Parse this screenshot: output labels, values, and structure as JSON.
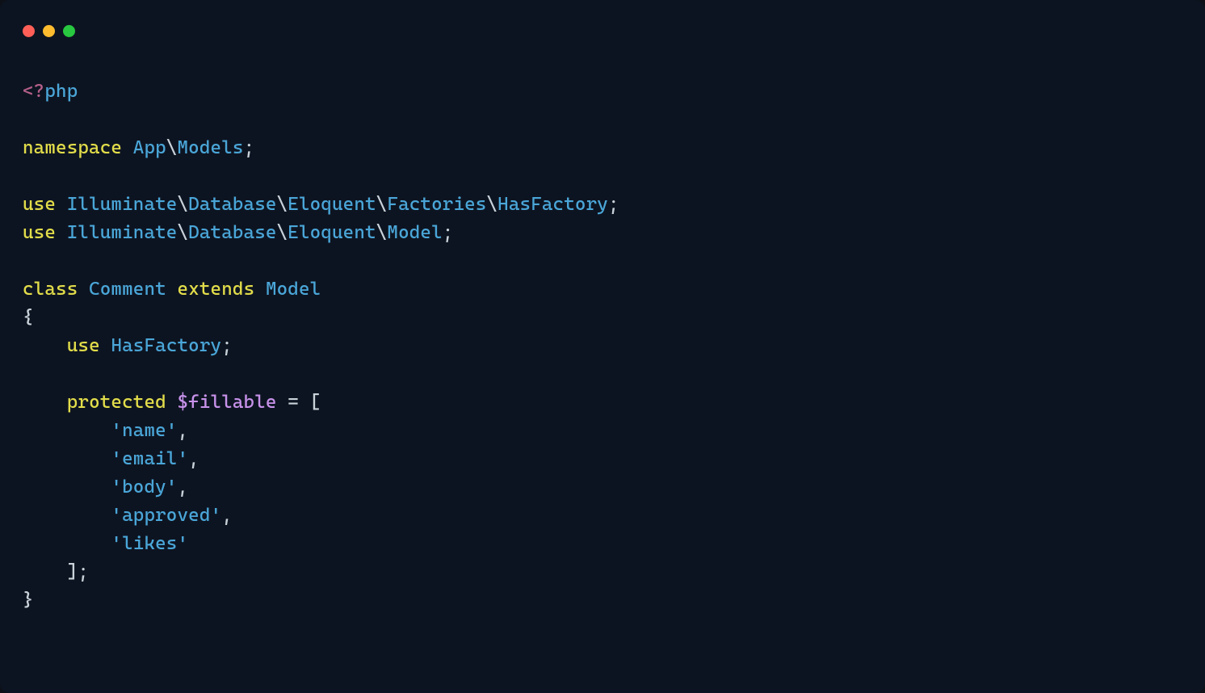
{
  "window": {
    "traffic_lights": [
      "close",
      "minimize",
      "zoom"
    ]
  },
  "colors": {
    "bg": "#0d1421",
    "keyword": "#e2dd4a",
    "type": "#4aa6d8",
    "variable": "#c792ea",
    "string": "#4aa6d8",
    "punct": "#c9d1d9",
    "tag_open": "#b5608a"
  },
  "code": {
    "open_tag_lt": "<?",
    "open_tag_php": "php",
    "kw_namespace": "namespace",
    "ns_app": "App",
    "ns_models": "Models",
    "kw_use": "use",
    "ns_illuminate": "Illuminate",
    "ns_database": "Database",
    "ns_eloquent": "Eloquent",
    "ns_factories": "Factories",
    "ns_hasfactory": "HasFactory",
    "ns_model": "Model",
    "kw_class": "class",
    "cls_comment": "Comment",
    "kw_extends": "extends",
    "brace_open": "{",
    "brace_close": "}",
    "bracket_open": "[",
    "bracket_close": "]",
    "kw_protected": "protected",
    "var_fillable": "$fillable",
    "eq": "=",
    "semicolon": ";",
    "backslash": "\\",
    "comma": ",",
    "fillable_items": {
      "i0": "'name'",
      "i1": "'email'",
      "i2": "'body'",
      "i3": "'approved'",
      "i4": "'likes'"
    }
  }
}
